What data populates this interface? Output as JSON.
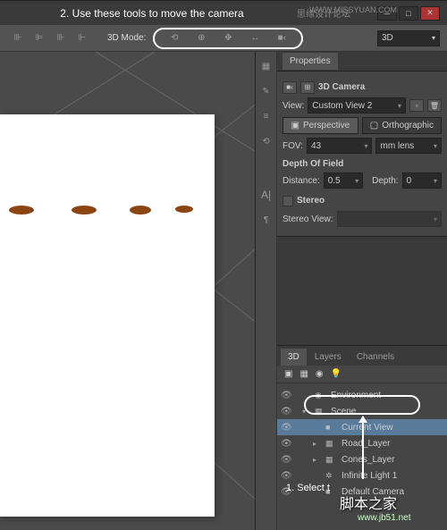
{
  "top": {
    "tip": "2. Use these tools to move the camera",
    "watermark": "思缘设计论坛",
    "url": "WWW.MISSYUAN.COM"
  },
  "toolbar": {
    "mode_label": "3D Mode:",
    "dropdown_3d": "3D"
  },
  "properties": {
    "tab": "Properties",
    "title": "3D Camera",
    "view_label": "View:",
    "view_value": "Custom View 2",
    "perspective": "Perspective",
    "orthographic": "Orthographic",
    "fov_label": "FOV:",
    "fov_value": "43",
    "fov_unit": "mm lens",
    "dof_header": "Depth Of Field",
    "distance_label": "Distance:",
    "distance_value": "0.5",
    "depth_label": "Depth:",
    "depth_value": "0",
    "stereo": "Stereo",
    "stereo_view_label": "Stereo View:"
  },
  "panels3d": {
    "tabs": [
      "3D",
      "Layers",
      "Channels"
    ],
    "tree": [
      {
        "icon": "◉",
        "label": "Environment",
        "indent": 0
      },
      {
        "icon": "▦",
        "label": "Scene",
        "indent": 0,
        "chev": "▾"
      },
      {
        "icon": "■",
        "label": "Current View",
        "indent": 1,
        "sel": true
      },
      {
        "icon": "▦",
        "label": "Road_Layer",
        "indent": 1,
        "chev": "▸"
      },
      {
        "icon": "▦",
        "label": "Cones_Layer",
        "indent": 1,
        "chev": "▸"
      },
      {
        "icon": "✲",
        "label": "Infinite Light 1",
        "indent": 1
      },
      {
        "icon": "■",
        "label": "Default Camera",
        "indent": 1
      }
    ]
  },
  "bottom_tip": "1. Select t",
  "watermark_main": "脚本之家",
  "watermark_url": "www.jb51.net"
}
